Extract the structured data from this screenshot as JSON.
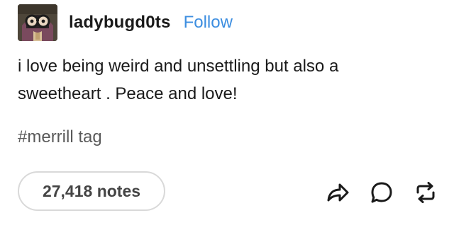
{
  "post": {
    "username": "ladybugd0ts",
    "follow_label": "Follow",
    "body_lines": [
      "i love being weird and unsettling but also a",
      "sweetheart . Peace and love!"
    ],
    "tag": "#merrill tag",
    "notes": "27,418 notes"
  },
  "icons": {
    "avatar": "avatar-image",
    "share": "share-icon",
    "reply": "reply-icon",
    "reblog": "reblog-icon"
  },
  "colors": {
    "follow": "#3d8ee0",
    "text": "#1a1a1a",
    "tag": "#5a5a5a",
    "pill_border": "#d9d9d9"
  }
}
